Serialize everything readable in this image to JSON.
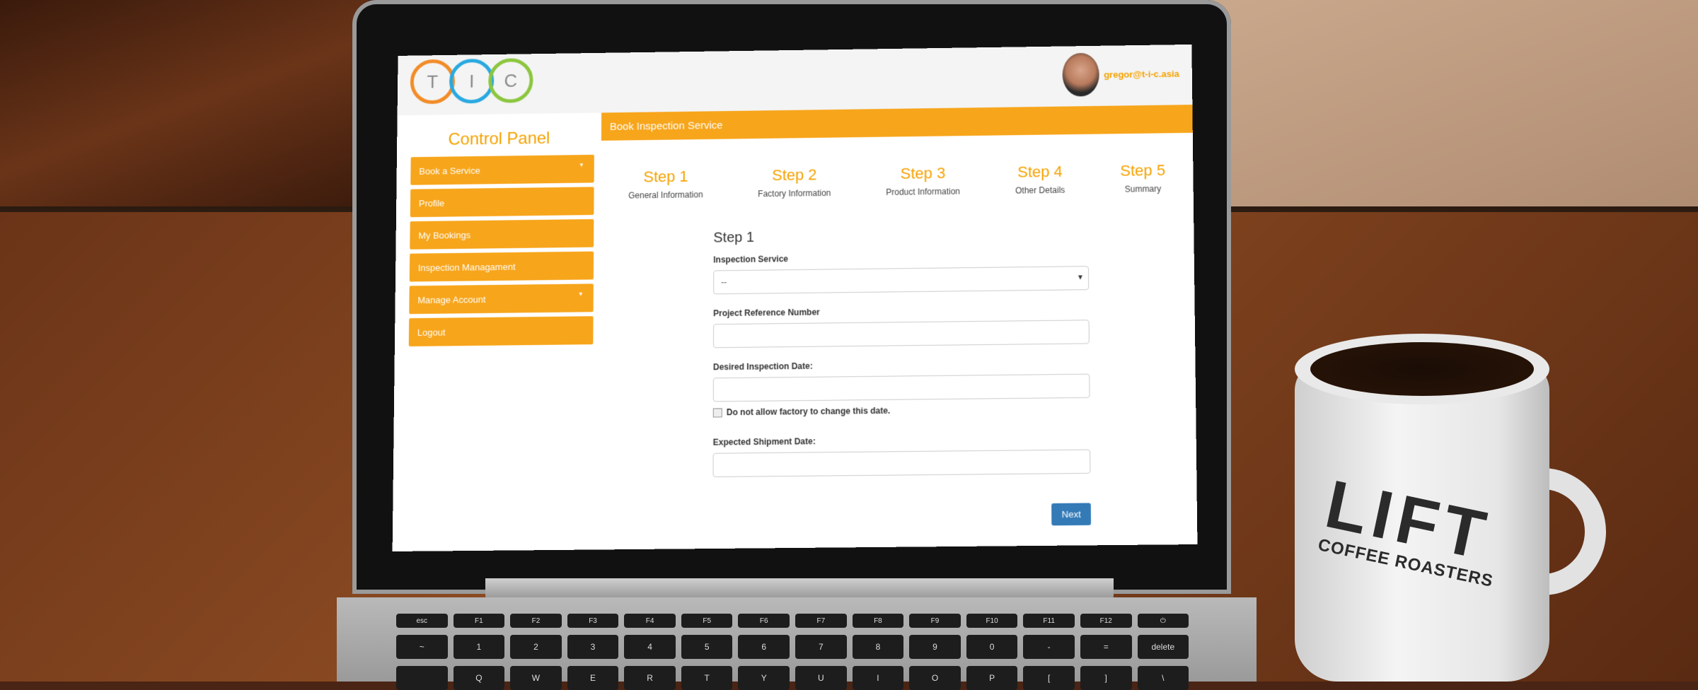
{
  "app": {
    "logo_letters": [
      "T",
      "I",
      "C"
    ],
    "logo_colors": [
      "#f28c28",
      "#29a9e0",
      "#8cc63f"
    ],
    "user_email": "gregor@t-i-c.asia"
  },
  "sidebar": {
    "title": "Control Panel",
    "items": [
      {
        "label": "Book a Service",
        "has_caret": true
      },
      {
        "label": "Profile",
        "has_caret": false
      },
      {
        "label": "My Bookings",
        "has_caret": false
      },
      {
        "label": "Inspection Managament",
        "has_caret": false
      },
      {
        "label": "Manage Account",
        "has_caret": true
      },
      {
        "label": "Logout",
        "has_caret": false
      }
    ]
  },
  "main": {
    "header": "Book Inspection Service",
    "steps": [
      {
        "num": "Step 1",
        "label": "General Information"
      },
      {
        "num": "Step 2",
        "label": "Factory Information"
      },
      {
        "num": "Step 3",
        "label": "Product Information"
      },
      {
        "num": "Step 4",
        "label": "Other Details"
      },
      {
        "num": "Step 5",
        "label": "Summary"
      }
    ],
    "form": {
      "title": "Step 1",
      "inspection_service_label": "Inspection Service",
      "inspection_service_value": "--",
      "project_ref_label": "Project Reference Number",
      "project_ref_value": "",
      "desired_date_label": "Desired Inspection Date:",
      "desired_date_value": "",
      "no_change_checkbox_label": "Do not allow factory to change this date.",
      "shipment_date_label": "Expected Shipment Date:",
      "shipment_date_value": "",
      "next_label": "Next"
    }
  },
  "keyboard": {
    "fn_row": [
      "esc",
      "F1",
      "F2",
      "F3",
      "F4",
      "F5",
      "F6",
      "F7",
      "F8",
      "F9",
      "F10",
      "F11",
      "F12",
      ""
    ],
    "num_row": [
      "~",
      "1",
      "2",
      "3",
      "4",
      "5",
      "6",
      "7",
      "8",
      "9",
      "0",
      "-",
      "=",
      "delete"
    ],
    "q_row": [
      "Q",
      "W",
      "E",
      "R",
      "T",
      "Y",
      "U",
      "I",
      "O",
      "P",
      "[",
      "]",
      "\\"
    ]
  },
  "mug": {
    "brand": "LIFT",
    "tagline": "COFFEE ROASTERS"
  }
}
